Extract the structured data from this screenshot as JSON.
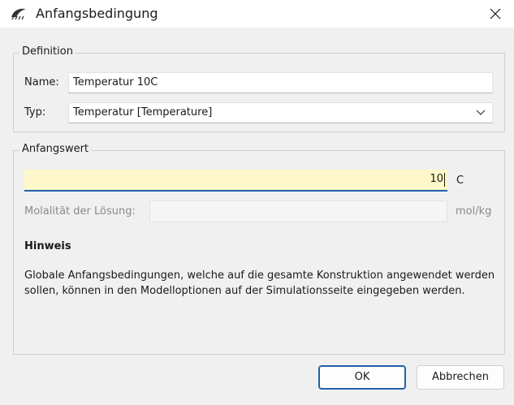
{
  "window": {
    "title": "Anfangsbedingung",
    "icon": "app-logo-icon",
    "close_icon": "close-icon"
  },
  "definition": {
    "group_label": "Definition",
    "name_label": "Name:",
    "name_value": "Temperatur 10C",
    "type_label": "Typ:",
    "type_value": "Temperatur [Temperature]"
  },
  "initial_value": {
    "group_label": "Anfangswert",
    "value": "10",
    "unit": "C",
    "molality_label": "Molalität der Lösung:",
    "molality_value": "",
    "molality_unit": "mol/kg",
    "hint_heading": "Hinweis",
    "hint_text": "Globale Anfangsbedingungen, welche auf die gesamte Konstruktion angewendet werden sollen, können in den Modelloptionen auf der Simulationsseite eingegeben werden."
  },
  "buttons": {
    "ok_label": "OK",
    "cancel_label": "Abbrechen"
  },
  "colors": {
    "accent": "#1f61a8",
    "value_field_bg": "#fdf7c9"
  }
}
